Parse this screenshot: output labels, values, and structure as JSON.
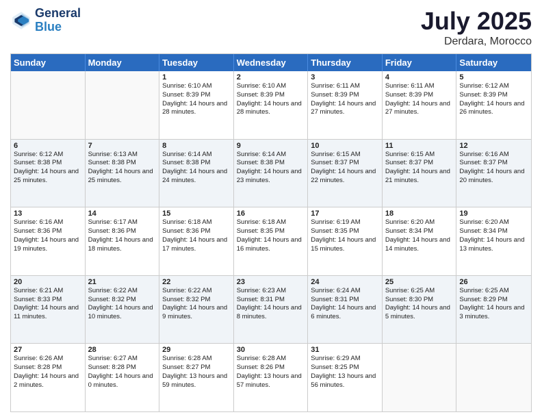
{
  "header": {
    "logo_general": "General",
    "logo_blue": "Blue",
    "month": "July 2025",
    "location": "Derdara, Morocco"
  },
  "weekdays": [
    "Sunday",
    "Monday",
    "Tuesday",
    "Wednesday",
    "Thursday",
    "Friday",
    "Saturday"
  ],
  "rows": [
    [
      {
        "day": "",
        "sunrise": "",
        "sunset": "",
        "daylight": "",
        "shaded": false,
        "empty": true
      },
      {
        "day": "",
        "sunrise": "",
        "sunset": "",
        "daylight": "",
        "shaded": false,
        "empty": true
      },
      {
        "day": "1",
        "sunrise": "Sunrise: 6:10 AM",
        "sunset": "Sunset: 8:39 PM",
        "daylight": "Daylight: 14 hours and 28 minutes.",
        "shaded": false,
        "empty": false
      },
      {
        "day": "2",
        "sunrise": "Sunrise: 6:10 AM",
        "sunset": "Sunset: 8:39 PM",
        "daylight": "Daylight: 14 hours and 28 minutes.",
        "shaded": false,
        "empty": false
      },
      {
        "day": "3",
        "sunrise": "Sunrise: 6:11 AM",
        "sunset": "Sunset: 8:39 PM",
        "daylight": "Daylight: 14 hours and 27 minutes.",
        "shaded": false,
        "empty": false
      },
      {
        "day": "4",
        "sunrise": "Sunrise: 6:11 AM",
        "sunset": "Sunset: 8:39 PM",
        "daylight": "Daylight: 14 hours and 27 minutes.",
        "shaded": false,
        "empty": false
      },
      {
        "day": "5",
        "sunrise": "Sunrise: 6:12 AM",
        "sunset": "Sunset: 8:39 PM",
        "daylight": "Daylight: 14 hours and 26 minutes.",
        "shaded": false,
        "empty": false
      }
    ],
    [
      {
        "day": "6",
        "sunrise": "Sunrise: 6:12 AM",
        "sunset": "Sunset: 8:38 PM",
        "daylight": "Daylight: 14 hours and 25 minutes.",
        "shaded": true,
        "empty": false
      },
      {
        "day": "7",
        "sunrise": "Sunrise: 6:13 AM",
        "sunset": "Sunset: 8:38 PM",
        "daylight": "Daylight: 14 hours and 25 minutes.",
        "shaded": true,
        "empty": false
      },
      {
        "day": "8",
        "sunrise": "Sunrise: 6:14 AM",
        "sunset": "Sunset: 8:38 PM",
        "daylight": "Daylight: 14 hours and 24 minutes.",
        "shaded": true,
        "empty": false
      },
      {
        "day": "9",
        "sunrise": "Sunrise: 6:14 AM",
        "sunset": "Sunset: 8:38 PM",
        "daylight": "Daylight: 14 hours and 23 minutes.",
        "shaded": true,
        "empty": false
      },
      {
        "day": "10",
        "sunrise": "Sunrise: 6:15 AM",
        "sunset": "Sunset: 8:37 PM",
        "daylight": "Daylight: 14 hours and 22 minutes.",
        "shaded": true,
        "empty": false
      },
      {
        "day": "11",
        "sunrise": "Sunrise: 6:15 AM",
        "sunset": "Sunset: 8:37 PM",
        "daylight": "Daylight: 14 hours and 21 minutes.",
        "shaded": true,
        "empty": false
      },
      {
        "day": "12",
        "sunrise": "Sunrise: 6:16 AM",
        "sunset": "Sunset: 8:37 PM",
        "daylight": "Daylight: 14 hours and 20 minutes.",
        "shaded": true,
        "empty": false
      }
    ],
    [
      {
        "day": "13",
        "sunrise": "Sunrise: 6:16 AM",
        "sunset": "Sunset: 8:36 PM",
        "daylight": "Daylight: 14 hours and 19 minutes.",
        "shaded": false,
        "empty": false
      },
      {
        "day": "14",
        "sunrise": "Sunrise: 6:17 AM",
        "sunset": "Sunset: 8:36 PM",
        "daylight": "Daylight: 14 hours and 18 minutes.",
        "shaded": false,
        "empty": false
      },
      {
        "day": "15",
        "sunrise": "Sunrise: 6:18 AM",
        "sunset": "Sunset: 8:36 PM",
        "daylight": "Daylight: 14 hours and 17 minutes.",
        "shaded": false,
        "empty": false
      },
      {
        "day": "16",
        "sunrise": "Sunrise: 6:18 AM",
        "sunset": "Sunset: 8:35 PM",
        "daylight": "Daylight: 14 hours and 16 minutes.",
        "shaded": false,
        "empty": false
      },
      {
        "day": "17",
        "sunrise": "Sunrise: 6:19 AM",
        "sunset": "Sunset: 8:35 PM",
        "daylight": "Daylight: 14 hours and 15 minutes.",
        "shaded": false,
        "empty": false
      },
      {
        "day": "18",
        "sunrise": "Sunrise: 6:20 AM",
        "sunset": "Sunset: 8:34 PM",
        "daylight": "Daylight: 14 hours and 14 minutes.",
        "shaded": false,
        "empty": false
      },
      {
        "day": "19",
        "sunrise": "Sunrise: 6:20 AM",
        "sunset": "Sunset: 8:34 PM",
        "daylight": "Daylight: 14 hours and 13 minutes.",
        "shaded": false,
        "empty": false
      }
    ],
    [
      {
        "day": "20",
        "sunrise": "Sunrise: 6:21 AM",
        "sunset": "Sunset: 8:33 PM",
        "daylight": "Daylight: 14 hours and 11 minutes.",
        "shaded": true,
        "empty": false
      },
      {
        "day": "21",
        "sunrise": "Sunrise: 6:22 AM",
        "sunset": "Sunset: 8:32 PM",
        "daylight": "Daylight: 14 hours and 10 minutes.",
        "shaded": true,
        "empty": false
      },
      {
        "day": "22",
        "sunrise": "Sunrise: 6:22 AM",
        "sunset": "Sunset: 8:32 PM",
        "daylight": "Daylight: 14 hours and 9 minutes.",
        "shaded": true,
        "empty": false
      },
      {
        "day": "23",
        "sunrise": "Sunrise: 6:23 AM",
        "sunset": "Sunset: 8:31 PM",
        "daylight": "Daylight: 14 hours and 8 minutes.",
        "shaded": true,
        "empty": false
      },
      {
        "day": "24",
        "sunrise": "Sunrise: 6:24 AM",
        "sunset": "Sunset: 8:31 PM",
        "daylight": "Daylight: 14 hours and 6 minutes.",
        "shaded": true,
        "empty": false
      },
      {
        "day": "25",
        "sunrise": "Sunrise: 6:25 AM",
        "sunset": "Sunset: 8:30 PM",
        "daylight": "Daylight: 14 hours and 5 minutes.",
        "shaded": true,
        "empty": false
      },
      {
        "day": "26",
        "sunrise": "Sunrise: 6:25 AM",
        "sunset": "Sunset: 8:29 PM",
        "daylight": "Daylight: 14 hours and 3 minutes.",
        "shaded": true,
        "empty": false
      }
    ],
    [
      {
        "day": "27",
        "sunrise": "Sunrise: 6:26 AM",
        "sunset": "Sunset: 8:28 PM",
        "daylight": "Daylight: 14 hours and 2 minutes.",
        "shaded": false,
        "empty": false
      },
      {
        "day": "28",
        "sunrise": "Sunrise: 6:27 AM",
        "sunset": "Sunset: 8:28 PM",
        "daylight": "Daylight: 14 hours and 0 minutes.",
        "shaded": false,
        "empty": false
      },
      {
        "day": "29",
        "sunrise": "Sunrise: 6:28 AM",
        "sunset": "Sunset: 8:27 PM",
        "daylight": "Daylight: 13 hours and 59 minutes.",
        "shaded": false,
        "empty": false
      },
      {
        "day": "30",
        "sunrise": "Sunrise: 6:28 AM",
        "sunset": "Sunset: 8:26 PM",
        "daylight": "Daylight: 13 hours and 57 minutes.",
        "shaded": false,
        "empty": false
      },
      {
        "day": "31",
        "sunrise": "Sunrise: 6:29 AM",
        "sunset": "Sunset: 8:25 PM",
        "daylight": "Daylight: 13 hours and 56 minutes.",
        "shaded": false,
        "empty": false
      },
      {
        "day": "",
        "sunrise": "",
        "sunset": "",
        "daylight": "",
        "shaded": false,
        "empty": true
      },
      {
        "day": "",
        "sunrise": "",
        "sunset": "",
        "daylight": "",
        "shaded": false,
        "empty": true
      }
    ]
  ]
}
